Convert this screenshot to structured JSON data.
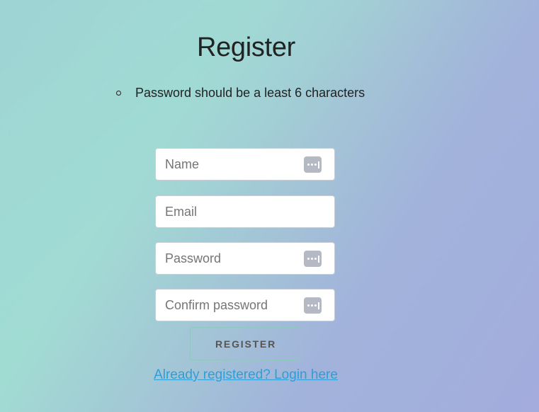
{
  "page": {
    "title": "Register"
  },
  "rules": [
    "Password should be a least 6 characters"
  ],
  "form": {
    "name": {
      "placeholder": "Name",
      "value": ""
    },
    "email": {
      "placeholder": "Email",
      "value": ""
    },
    "password": {
      "placeholder": "Password",
      "value": ""
    },
    "confirm_password": {
      "placeholder": "Confirm password",
      "value": ""
    }
  },
  "register_button": {
    "label": "REGISTER"
  },
  "login_link": {
    "label": "Already registered? Login here"
  },
  "icons": {
    "password_manager": "password-manager-icon"
  },
  "colors": {
    "link": "#2d9fd6",
    "title": "#222222",
    "field_icon_bg": "#b5b9c3"
  }
}
